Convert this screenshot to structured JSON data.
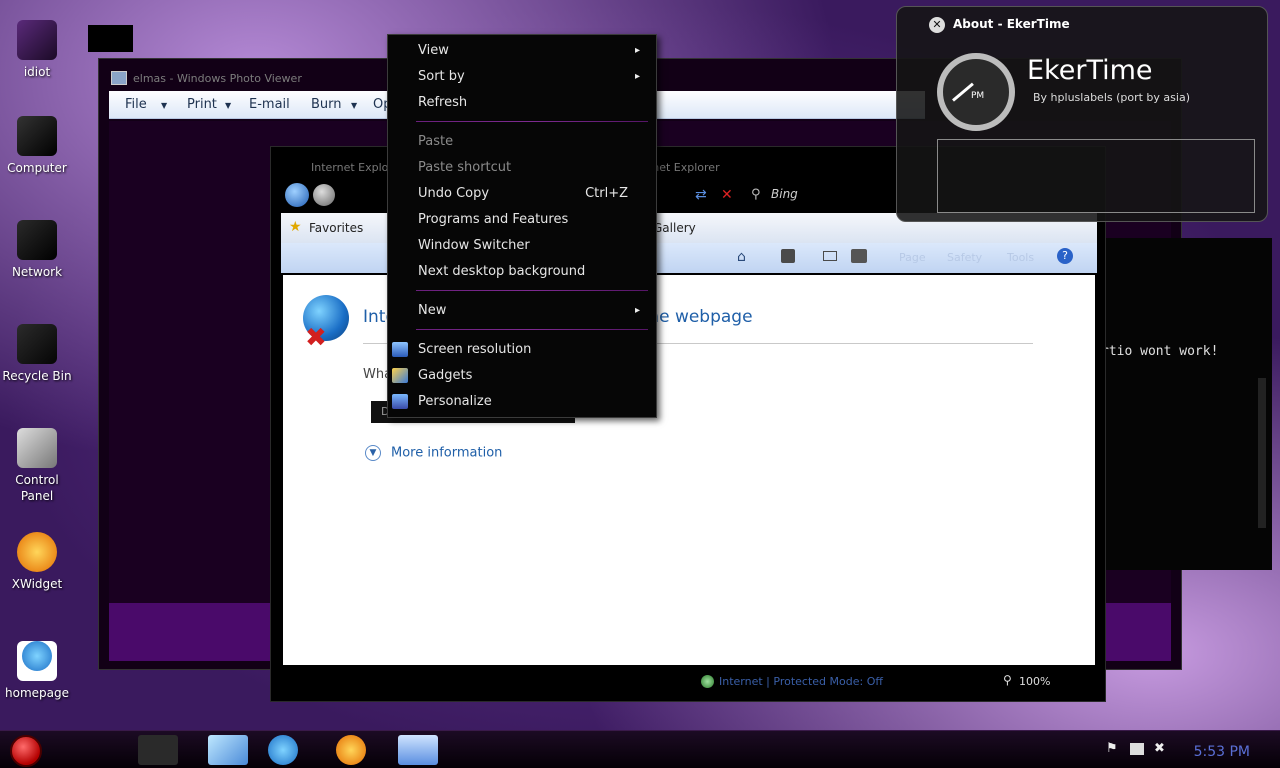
{
  "desktop_icons": [
    {
      "label": "idiot"
    },
    {
      "label": "Computer"
    },
    {
      "label": "Network"
    },
    {
      "label": "Recycle Bin"
    },
    {
      "label": "Control Panel"
    },
    {
      "label": "XWidget"
    },
    {
      "label": "homepage"
    }
  ],
  "photo_viewer": {
    "title": "elmas - Windows Photo Viewer",
    "menu": [
      "File",
      "Print",
      "E-mail",
      "Burn",
      "Open"
    ]
  },
  "ie": {
    "title": "Internet Explorer cannot display the webpage - Windows Internet Explorer",
    "search_engine": "Bing",
    "favorites_label": "Favorites",
    "gallery_label": "Gallery",
    "page_heading": "Internet Explorer cannot display the webpage",
    "what_label": "What you can try:",
    "diagnose_label": "Diagnose Connection Problems",
    "more_info": "More information",
    "status_zone": "Internet | Protected Mode: Off",
    "zoom": "100%",
    "cmd_items": [
      "Page",
      "Safety",
      "Tools"
    ]
  },
  "terminal": {
    "line": "rtio wont work!"
  },
  "context_menu": {
    "items": [
      {
        "label": "View",
        "submenu": true
      },
      {
        "label": "Sort by",
        "submenu": true
      },
      {
        "label": "Refresh"
      },
      {
        "label": "Paste",
        "disabled": true
      },
      {
        "label": "Paste shortcut",
        "disabled": true
      },
      {
        "label": "Undo Copy",
        "shortcut": "Ctrl+Z"
      },
      {
        "label": "Programs and Features"
      },
      {
        "label": "Window Switcher"
      },
      {
        "label": "Next desktop background"
      },
      {
        "label": "New",
        "submenu": true
      },
      {
        "label": "Screen resolution",
        "icon": "monitor-icon"
      },
      {
        "label": "Gadgets",
        "icon": "gadgets-icon"
      },
      {
        "label": "Personalize",
        "icon": "personalize-icon"
      }
    ],
    "arrow_glyph": "▸"
  },
  "about": {
    "title": "About - EkerTime",
    "app_name": "EkerTime",
    "byline": "By hpluslabels (port by asia)",
    "clock_period": "PM",
    "close_glyph": "✕"
  },
  "taskbar": {
    "clock": "5:53 PM"
  },
  "colors": {
    "accent": "#7d2a90",
    "clock_text": "#5a6fd6",
    "link_blue": "#1f5fa8"
  }
}
